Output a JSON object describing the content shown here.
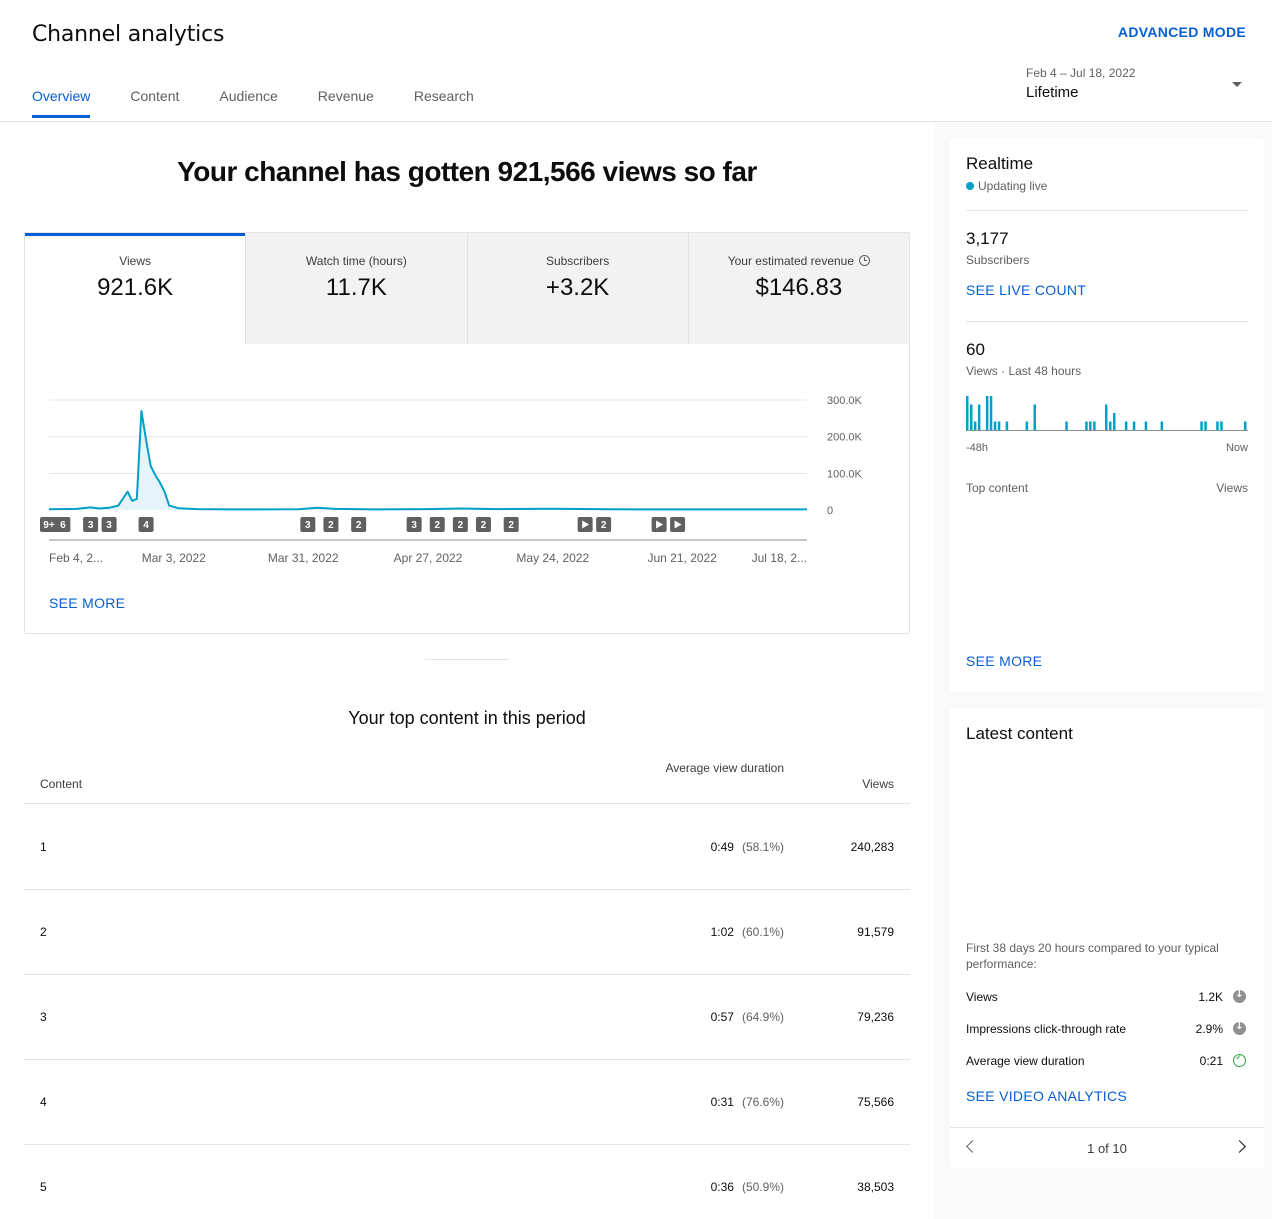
{
  "header": {
    "title": "Channel analytics",
    "advanced_mode": "ADVANCED MODE",
    "tabs": [
      {
        "label": "Overview"
      },
      {
        "label": "Content"
      },
      {
        "label": "Audience"
      },
      {
        "label": "Revenue"
      },
      {
        "label": "Research"
      }
    ],
    "date_range": "Feb 4 – Jul 18, 2022",
    "date_label": "Lifetime"
  },
  "hero": "Your channel has gotten 921,566 views so far",
  "metrics": [
    {
      "name": "Views",
      "value": "921.6K"
    },
    {
      "name": "Watch time (hours)",
      "value": "11.7K"
    },
    {
      "name": "Subscribers",
      "value": "+3.2K"
    },
    {
      "name": "Your estimated revenue",
      "value": "$146.83"
    }
  ],
  "see_more": "SEE MORE",
  "chart_data": {
    "type": "line",
    "xlabel": "",
    "ylabel": "",
    "ylim": [
      0,
      300000
    ],
    "y_ticks": [
      "300.0K",
      "200.0K",
      "100.0K",
      "0"
    ],
    "x_tick_labels": [
      "Feb 4, 2...",
      "Mar 3, 2022",
      "Mar 31, 2022",
      "Apr 27, 2022",
      "May 24, 2022",
      "Jun 21, 2022",
      "Jul 18, 2..."
    ],
    "x_tick_dates": [
      "2022-02-04",
      "2022-03-03",
      "2022-03-31",
      "2022-04-27",
      "2022-05-24",
      "2022-06-21",
      "2022-07-18"
    ],
    "series": [
      {
        "color": "#00a0c8",
        "points": [
          [
            "2022-02-04",
            2000
          ],
          [
            "2022-02-10",
            3000
          ],
          [
            "2022-02-13",
            7000
          ],
          [
            "2022-02-15",
            4000
          ],
          [
            "2022-02-17",
            6000
          ],
          [
            "2022-02-19",
            12000
          ],
          [
            "2022-02-21",
            50000
          ],
          [
            "2022-02-22",
            25000
          ],
          [
            "2022-02-23",
            30000
          ],
          [
            "2022-02-24",
            270000
          ],
          [
            "2022-02-25",
            190000
          ],
          [
            "2022-02-26",
            120000
          ],
          [
            "2022-02-27",
            95000
          ],
          [
            "2022-02-28",
            75000
          ],
          [
            "2022-03-01",
            50000
          ],
          [
            "2022-03-02",
            12000
          ],
          [
            "2022-03-04",
            5000
          ],
          [
            "2022-03-08",
            2500
          ],
          [
            "2022-03-15",
            1500
          ],
          [
            "2022-03-30",
            2000
          ],
          [
            "2022-04-03",
            6000
          ],
          [
            "2022-04-07",
            3000
          ],
          [
            "2022-04-15",
            1500
          ],
          [
            "2022-04-27",
            2500
          ],
          [
            "2022-05-04",
            4000
          ],
          [
            "2022-05-12",
            2500
          ],
          [
            "2022-05-24",
            3500
          ],
          [
            "2022-06-05",
            2000
          ],
          [
            "2022-06-21",
            1500
          ],
          [
            "2022-07-05",
            1500
          ],
          [
            "2022-07-18",
            1500
          ]
        ]
      }
    ],
    "markers": [
      {
        "label": "9+",
        "date": "2022-02-04"
      },
      {
        "label": "6",
        "date": "2022-02-07"
      },
      {
        "label": "3",
        "date": "2022-02-13"
      },
      {
        "label": "3",
        "date": "2022-02-17"
      },
      {
        "label": "4",
        "date": "2022-02-25"
      },
      {
        "label": "3",
        "date": "2022-04-01"
      },
      {
        "label": "2",
        "date": "2022-04-06"
      },
      {
        "label": "2",
        "date": "2022-04-12"
      },
      {
        "label": "3",
        "date": "2022-04-24"
      },
      {
        "label": "2",
        "date": "2022-04-29"
      },
      {
        "label": "2",
        "date": "2022-05-04"
      },
      {
        "label": "2",
        "date": "2022-05-09"
      },
      {
        "label": "2",
        "date": "2022-05-15"
      },
      {
        "label": "▶",
        "date": "2022-05-31"
      },
      {
        "label": "2",
        "date": "2022-06-04"
      },
      {
        "label": "▶",
        "date": "2022-06-16"
      },
      {
        "label": "▶",
        "date": "2022-06-20"
      }
    ]
  },
  "top_content": {
    "title": "Your top content in this period",
    "col_content": "Content",
    "col_avd": "Average view duration",
    "col_views": "Views",
    "rows": [
      {
        "rank": "1",
        "duration": "0:49",
        "pct": "(58.1%)",
        "views": "240,283"
      },
      {
        "rank": "2",
        "duration": "1:02",
        "pct": "(60.1%)",
        "views": "91,579"
      },
      {
        "rank": "3",
        "duration": "0:57",
        "pct": "(64.9%)",
        "views": "79,236"
      },
      {
        "rank": "4",
        "duration": "0:31",
        "pct": "(76.6%)",
        "views": "75,566"
      },
      {
        "rank": "5",
        "duration": "0:36",
        "pct": "(50.9%)",
        "views": "38,503"
      }
    ]
  },
  "realtime": {
    "title": "Realtime",
    "live": "Updating live",
    "subscribers_value": "3,177",
    "subscribers_label": "Subscribers",
    "see_live_count": "SEE LIVE COUNT",
    "views_value": "60",
    "views_label": "Views · Last 48 hours",
    "axis_start": "-48h",
    "axis_end": "Now",
    "hourly_views": [
      4,
      3,
      1,
      3,
      0,
      4,
      4,
      1,
      1,
      0,
      1,
      0,
      0,
      0,
      0,
      1,
      0,
      3,
      0,
      0,
      0,
      0,
      0,
      0,
      0,
      1,
      0,
      0,
      0,
      0,
      1,
      1,
      1,
      0,
      0,
      3,
      1,
      2,
      0,
      0,
      1,
      0,
      1,
      0,
      0,
      1,
      0,
      0,
      0,
      1,
      0,
      0,
      0,
      0,
      0,
      0,
      0,
      0,
      0,
      1,
      1,
      0,
      0,
      1,
      1,
      0,
      0,
      0,
      0,
      0,
      1
    ],
    "top_content_label": "Top content",
    "views_col": "Views",
    "see_more": "SEE MORE"
  },
  "latest": {
    "title": "Latest content",
    "note": "First 38 days 20 hours compared to your typical performance:",
    "stats": [
      {
        "label": "Views",
        "value": "1.2K",
        "status_icon": "arrow-down-icon"
      },
      {
        "label": "Impressions click-through rate",
        "value": "2.9%",
        "status_icon": "arrow-down-icon"
      },
      {
        "label": "Average view duration",
        "value": "0:21",
        "status_icon": "check-circle-icon"
      }
    ],
    "see_video_analytics": "SEE VIDEO ANALYTICS",
    "pager": "1 of 10"
  },
  "colors": {
    "accent": "#065fd4",
    "series": "#00a0c8"
  }
}
